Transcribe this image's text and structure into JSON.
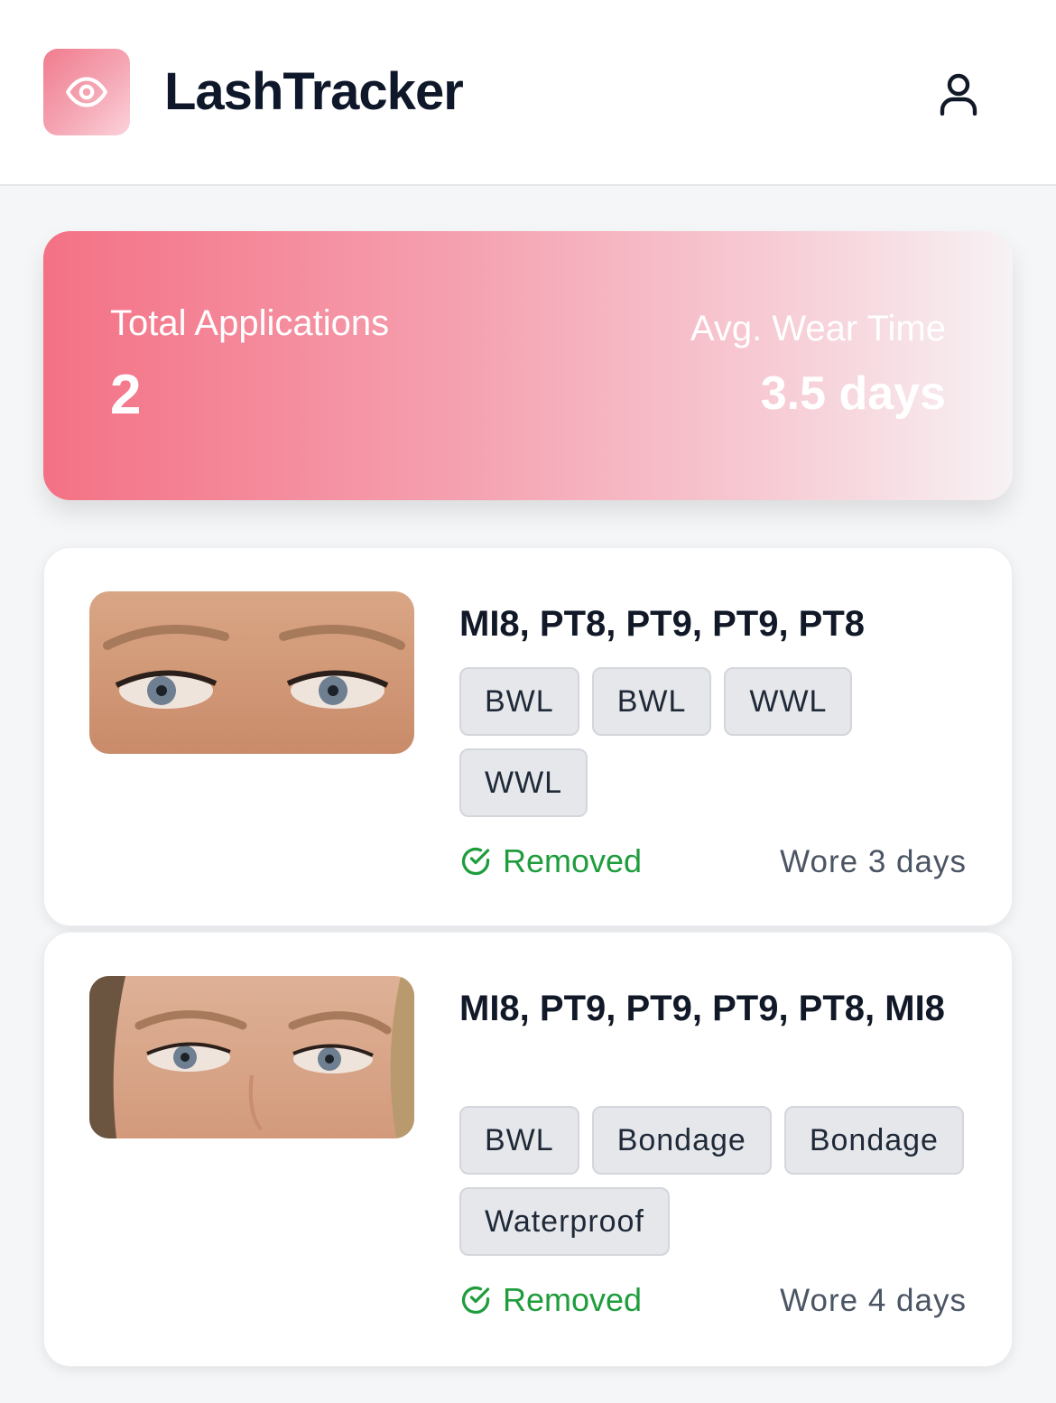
{
  "app": {
    "title": "LashTracker",
    "logo_icon": "eye-icon",
    "user_icon": "user-icon",
    "accent_color": "#f47185"
  },
  "stats": {
    "total_label": "Total Applications",
    "total_value": "2",
    "avg_label": "Avg. Wear Time",
    "avg_value": "3.5 days"
  },
  "applications": [
    {
      "title": "MI8, PT8, PT9, PT9, PT8",
      "tags": [
        "BWL",
        "BWL",
        "WWL",
        "WWL"
      ],
      "status": "Removed",
      "status_icon": "check-circle-icon",
      "wore": "Wore 3 days"
    },
    {
      "title": "MI8, PT9, PT9, PT9, PT8, MI8",
      "tags": [
        "BWL",
        "Bondage",
        "Bondage",
        "Waterproof"
      ],
      "status": "Removed",
      "status_icon": "check-circle-icon",
      "wore": "Wore 4 days"
    }
  ]
}
